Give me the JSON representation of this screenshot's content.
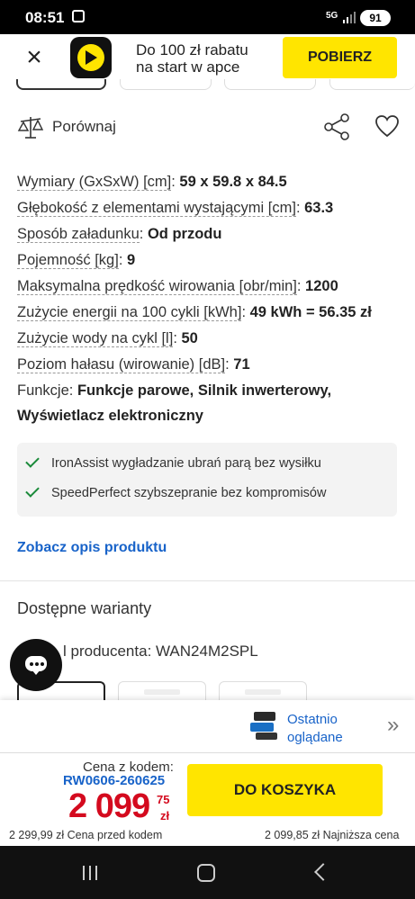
{
  "status_bar": {
    "time": "08:51",
    "network": "5G",
    "battery": "91"
  },
  "app_banner": {
    "text_line1": "Do 100 zł rabatu",
    "text_line2": "na start w apce",
    "download_label": "POBIERZ"
  },
  "compare": {
    "label": "Porównaj"
  },
  "specs": [
    {
      "key": "Wymiary (GxSxW) [cm]",
      "value": "59 x 59.8 x 84.5"
    },
    {
      "key": "Głębokość z elementami wystającymi [cm]",
      "value": "63.3"
    },
    {
      "key": "Sposób załadunku",
      "value": "Od przodu"
    },
    {
      "key": "Pojemność [kg]",
      "value": "9"
    },
    {
      "key": "Maksymalna prędkość wirowania [obr/min]",
      "value": "1200"
    },
    {
      "key": "Zużycie energii na 100 cykli [kWh]",
      "value": "49 kWh = 56.35 zł"
    },
    {
      "key": "Zużycie wody na cykl [l]",
      "value": "50"
    },
    {
      "key": "Poziom hałasu (wirowanie) [dB]",
      "value": "71"
    }
  ],
  "functions": {
    "key": "Funkcje",
    "value_line1": "Funkcje parowe, Silnik inwerterowy,",
    "value_line2": "Wyświetlacz elektroniczny"
  },
  "features": [
    "IronAssist wygładzanie ubrań parą bez wysiłku",
    "SpeedPerfect szybszepranie bez kompromisów"
  ],
  "description_link": "Zobacz opis produktu",
  "variants": {
    "title": "Dostępne warianty",
    "model_text": "l producenta: WAN24M2SPL"
  },
  "recently_viewed": {
    "line1": "Ostatnio",
    "line2": "oglądane"
  },
  "price": {
    "code_label": "Cena z kodem:",
    "code": "RW0606-260625",
    "main": "2 099",
    "cents": "75",
    "currency": "zł",
    "cart_label": "DO KOSZYKA",
    "before_code": "2 299,99 zł Cena przed kodem",
    "lowest": "2 099,85 zł Najniższa cena"
  },
  "colors": {
    "accent_yellow": "#ffe500",
    "link_blue": "#1863c9",
    "price_red": "#d40a1e",
    "check_green": "#1a8a3a"
  }
}
